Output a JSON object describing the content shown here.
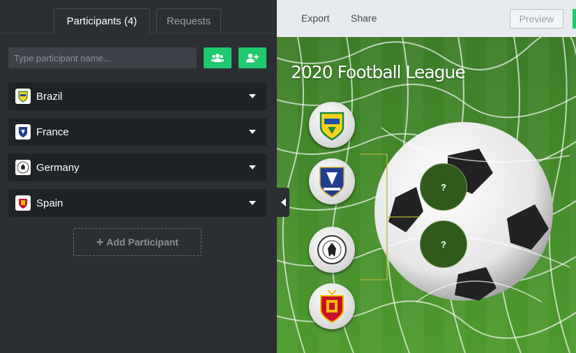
{
  "sidebar": {
    "tabs": [
      {
        "label": "Participants (4)",
        "active": true
      },
      {
        "label": "Requests",
        "active": false
      }
    ],
    "search": {
      "placeholder": "Type participant name...",
      "value": ""
    },
    "buttons": {
      "add_group_icon": "users-icon",
      "add_user_icon": "user-plus-icon"
    },
    "participants": [
      {
        "name": "Brazil",
        "flag": "brazil-crest-icon"
      },
      {
        "name": "France",
        "flag": "france-crest-icon"
      },
      {
        "name": "Germany",
        "flag": "germany-crest-icon"
      },
      {
        "name": "Spain",
        "flag": "spain-crest-icon"
      }
    ],
    "add_participant": {
      "plus": "+",
      "label": "Add Participant"
    }
  },
  "toolbar": {
    "export_label": "Export",
    "share_label": "Share",
    "preview_label": "Preview"
  },
  "bracket": {
    "title": "2020 Football League",
    "slots": [
      {
        "label": "?"
      },
      {
        "label": "?"
      }
    ]
  },
  "colors": {
    "accent": "#1fca6e",
    "sidebar": "#2b2f34",
    "row": "#1f2226",
    "slot": "#2f5a1c"
  }
}
